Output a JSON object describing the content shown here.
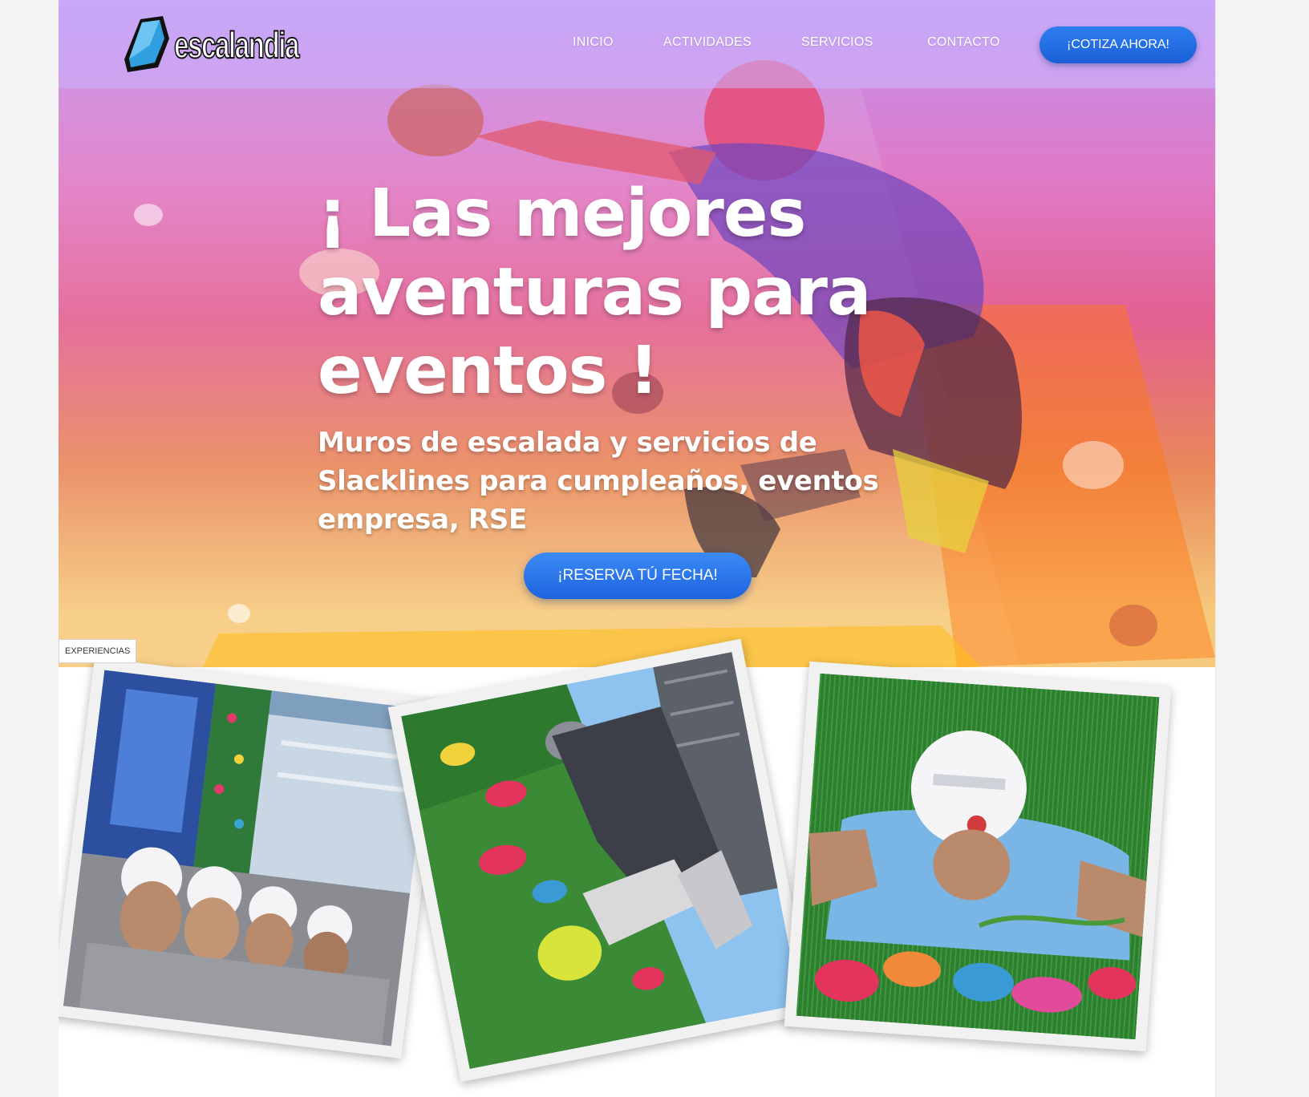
{
  "brand": {
    "name": "escalandia"
  },
  "nav": {
    "items": [
      {
        "label": "INICIO"
      },
      {
        "label": "ACTIVIDADES"
      },
      {
        "label": "SERVICIOS"
      },
      {
        "label": "CONTACTO"
      }
    ],
    "cta_label": "¡COTIZA AHORA!"
  },
  "hero": {
    "headline": "¡ Las mejores aventuras para eventos !",
    "subheadline": "Muros de escalada y servicios de Slacklines para cumpleaños, eventos empresa, RSE",
    "cta_label": "¡RESERVA TÚ FECHA!"
  },
  "experiences": {
    "label": "EXPERIENCIAS"
  },
  "colors": {
    "accent_blue": "#1d63de",
    "nav_tint": "#cdb9ff"
  }
}
